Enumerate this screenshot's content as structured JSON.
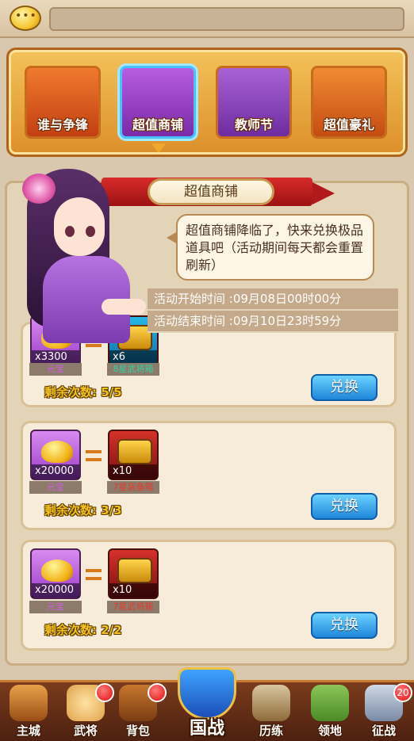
{
  "tabs": [
    {
      "label": "谁与争锋"
    },
    {
      "label": "超值商铺"
    },
    {
      "label": "教师节"
    },
    {
      "label": "超值豪礼"
    }
  ],
  "shop": {
    "title": "超值商铺",
    "message": "超值商铺降临了，快来兑换极品道具吧（活动期间每天都会重置刷新）",
    "start_time": "活动开始时间 :09月08日00时00分",
    "end_time": "活动结束时间 :09月10日23时59分"
  },
  "offers": [
    {
      "cost_qty": "x3300",
      "cost_name": "元宝",
      "reward_qty": "x6",
      "reward_name": "8星武将箱",
      "remaining": "剩余次数: 5/5",
      "button": "兑换"
    },
    {
      "cost_qty": "x20000",
      "cost_name": "元宝",
      "reward_qty": "x10",
      "reward_name": "7星装备箱",
      "remaining": "剩余次数: 3/3",
      "button": "兑换"
    },
    {
      "cost_qty": "x20000",
      "cost_name": "元宝",
      "reward_qty": "x10",
      "reward_name": "7星武将箱",
      "remaining": "剩余次数: 2/2",
      "button": "兑换"
    }
  ],
  "nav": {
    "items": [
      {
        "label": "主城"
      },
      {
        "label": "武将"
      },
      {
        "label": "背包"
      },
      {
        "label": "国战"
      },
      {
        "label": "历练"
      },
      {
        "label": "领地"
      },
      {
        "label": "征战",
        "badge": "20"
      }
    ]
  },
  "colors": {
    "accent_tab_selected": "#44c3ff",
    "button_blue": "#1f86d9",
    "remaining_text": "#f2c21b",
    "ribbon_red": "#c21b1b"
  }
}
